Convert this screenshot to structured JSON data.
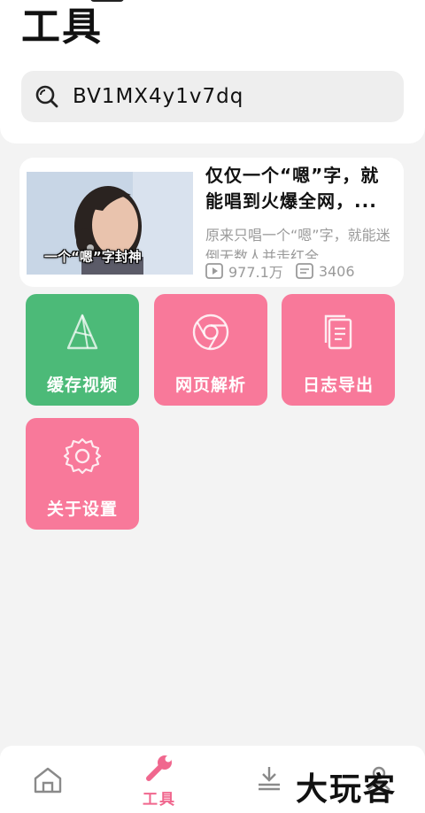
{
  "header": {
    "title": "工具"
  },
  "search": {
    "value": "BV1MX4y1v7dq"
  },
  "video": {
    "thumbnail_caption": "一个“嗯”字封神",
    "title": "仅仅一个“嗯”字，就能唱到火爆全网，...",
    "description": "原来只唱一个“嗯”字，就能迷倒无数人并走红全",
    "views": "977.1万",
    "comments": "3406"
  },
  "tools": [
    {
      "label": "缓存视频",
      "icon": "cache-video-icon",
      "color": "#4cba78"
    },
    {
      "label": "网页解析",
      "icon": "browser-icon",
      "color": "#f8799a"
    },
    {
      "label": "日志导出",
      "icon": "document-icon",
      "color": "#f8799a"
    },
    {
      "label": "关于设置",
      "icon": "gear-icon",
      "color": "#f8799a"
    }
  ],
  "nav": {
    "active_label": "工具",
    "accent": "#f0678e"
  },
  "watermark": "大玩客"
}
